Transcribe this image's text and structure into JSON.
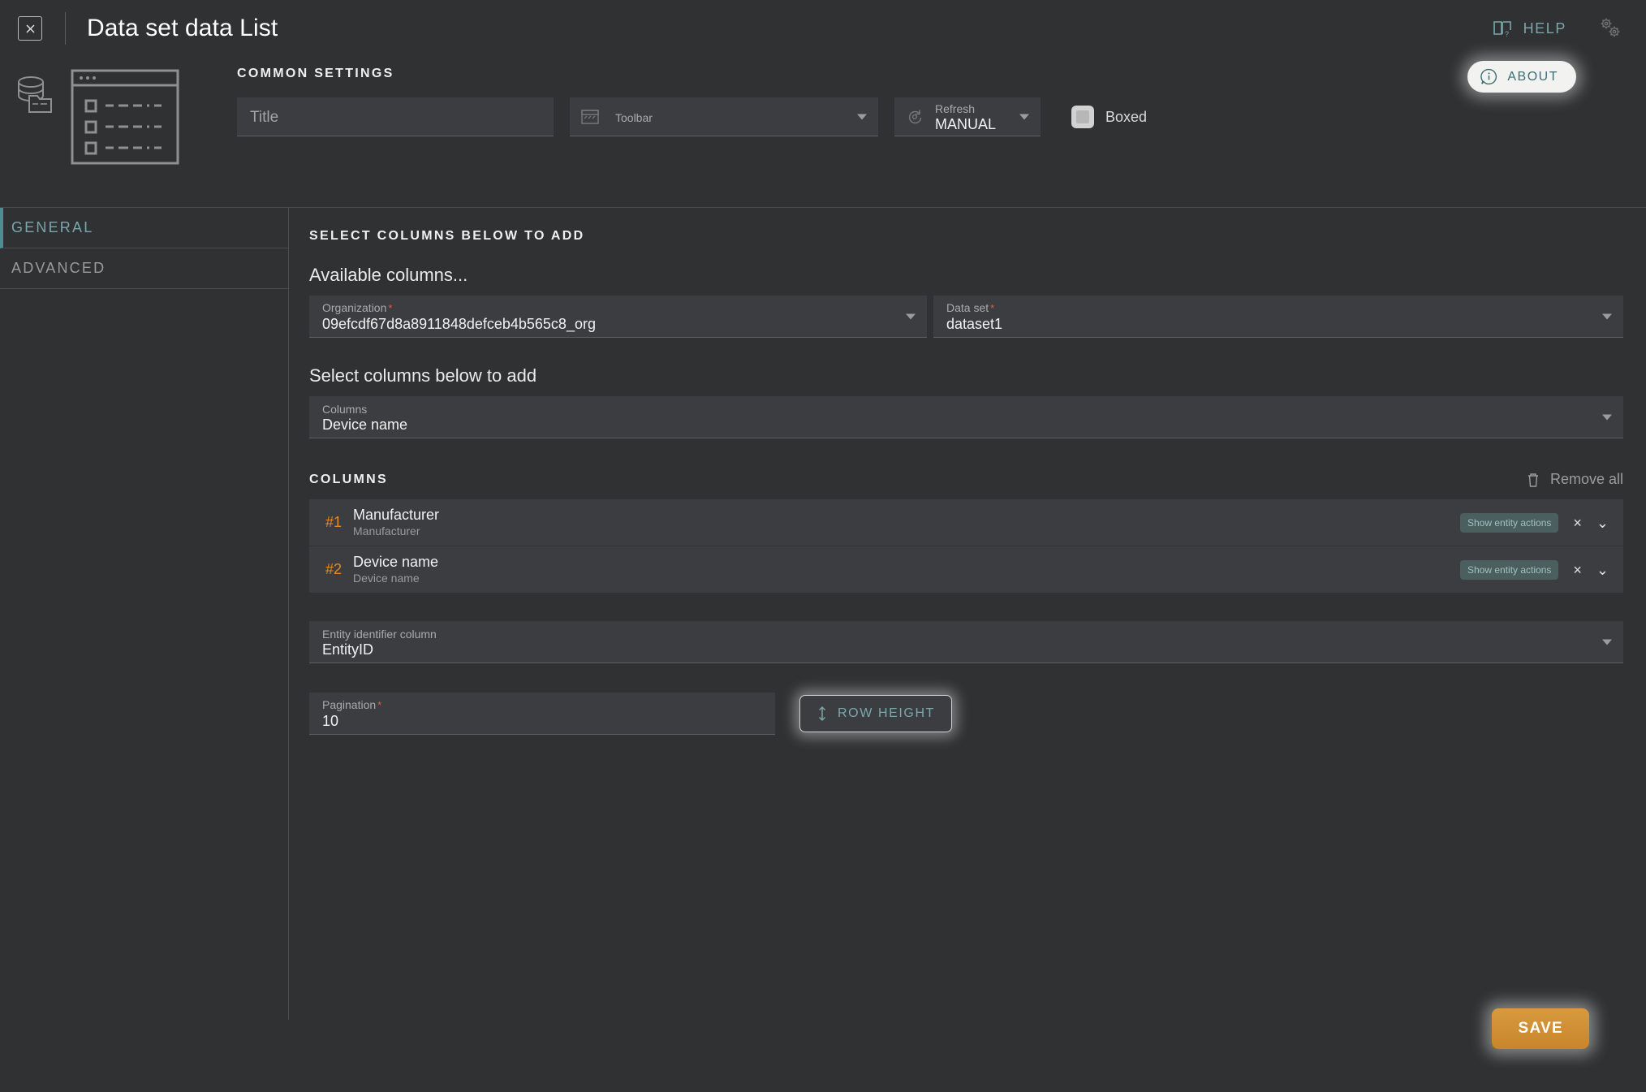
{
  "topbar": {
    "close_label": "×",
    "title": "Data set data List",
    "help_label": "HELP",
    "about_label": "ABOUT"
  },
  "common_settings": {
    "caption": "COMMON SETTINGS",
    "title_field": {
      "label": "",
      "placeholder": "Title",
      "value": ""
    },
    "toolbar_field": {
      "label": "Toolbar",
      "value": ""
    },
    "refresh_field": {
      "label": "Refresh",
      "value": "MANUAL"
    },
    "boxed": {
      "label": "Boxed",
      "checked": false
    }
  },
  "sidebar": {
    "items": [
      {
        "label": "GENERAL",
        "active": true
      },
      {
        "label": "ADVANCED",
        "active": false
      }
    ]
  },
  "main": {
    "caption": "SELECT COLUMNS BELOW TO ADD",
    "available_columns_heading": "Available columns...",
    "organization": {
      "label": "Organization",
      "required": true,
      "value": "09efcdf67d8a8911848defceb4b565c8_org"
    },
    "dataset": {
      "label": "Data set",
      "required": true,
      "value": "dataset1"
    },
    "select_columns_heading": "Select columns below to add",
    "columns_select": {
      "label": "Columns",
      "value": "Device name"
    },
    "columns_caption": "COLUMNS",
    "remove_all_label": "Remove all",
    "columns": [
      {
        "index": "#1",
        "title": "Manufacturer",
        "subtitle": "Manufacturer",
        "badge": "Show entity actions",
        "remove": "×",
        "expand": "⌄"
      },
      {
        "index": "#2",
        "title": "Device name",
        "subtitle": "Device name",
        "badge": "Show entity actions",
        "remove": "×",
        "expand": "⌄"
      }
    ],
    "entity_identifier": {
      "label": "Entity identifier column",
      "value": "EntityID"
    },
    "pagination": {
      "label": "Pagination",
      "required": true,
      "value": "10"
    },
    "row_height_label": "ROW HEIGHT"
  },
  "footer": {
    "save_label": "SAVE"
  },
  "colors": {
    "background": "#2f3133",
    "field": "#3b3d40",
    "accent_teal": "#7aa7ab",
    "accent_orange": "#e08a2b",
    "save_orange": "#c9852b",
    "required_red": "#e05a4a"
  }
}
